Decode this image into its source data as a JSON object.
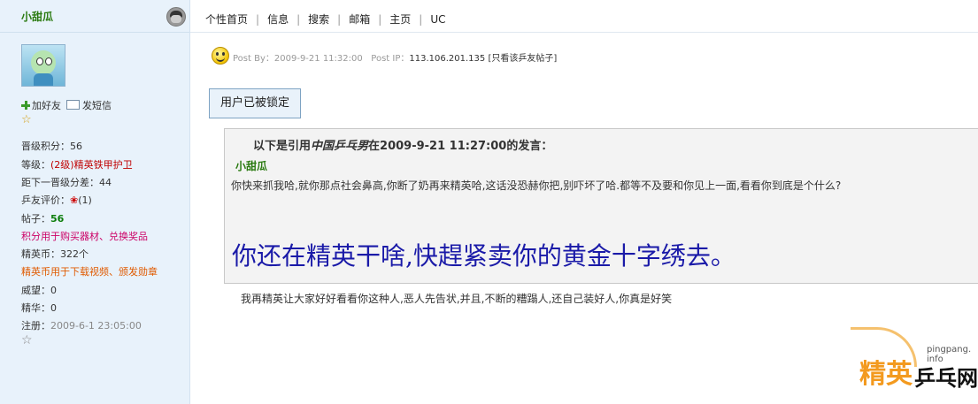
{
  "sidebar": {
    "username": "小甜瓜",
    "add_friend": "加好友",
    "send_message": "发短信",
    "stats": {
      "points_label": "晋级积分：",
      "points_value": "56",
      "level_label": "等级：",
      "level_value": "(2级)精英铁甲护卫",
      "next_label": "距下一晋级分差：",
      "next_value": "44",
      "rating_label": "乒友评价：",
      "rating_value": "(1)",
      "posts_label": "帖子：",
      "posts_value": "56",
      "points_note": "积分用于购买器材、兑换奖品",
      "coins_label": "精英币：",
      "coins_value": "322个",
      "coins_note": "精英币用于下载视频、颁发勋章",
      "prestige_label": "威望：",
      "prestige_value": "0",
      "essence_label": "精华：",
      "essence_value": "0",
      "register_label": "注册：",
      "register_value": "2009-6-1 23:05:00"
    }
  },
  "topnav": [
    "个性首页",
    "信息",
    "搜索",
    "邮箱",
    "主页",
    "UC"
  ],
  "post": {
    "postby_label": "Post By：",
    "postby_value": "2009-9-21 11:32:00",
    "ip_label": "Post IP：",
    "ip_value": "113.106.201.135",
    "only_author": "[只看该乒友帖子]",
    "locked_notice": "用户已被锁定",
    "quote": {
      "title_prefix": "以下是引用",
      "title_author": "中国乒乓男",
      "title_suffix": "在2009-9-21 11:27:00的发言：",
      "user": "小甜瓜",
      "text": "你快来抓我哈,就你那点社会鼻高,你断了奶再来精英哈,这话没恐赫你把,别吓坏了哈.都等不及要和你见上一面,看看你到底是个什么?",
      "big": "你还在精英干啥,快趕紧卖你的黄金十字绣去。"
    },
    "reply": "我再精英让大家好好看看你这种人,恶人先告状,并且,不断的糟蹋人,还自己装好人,你真是好笑"
  },
  "watermark": {
    "url": "pingpang. info",
    "brand1": "精英",
    "brand2": "乒乓网"
  },
  "colors": {
    "sidebar_bg": "#e8f2fb",
    "username": "#2a7a10",
    "level": "#c00000",
    "big_quote": "#1a1aa8"
  }
}
